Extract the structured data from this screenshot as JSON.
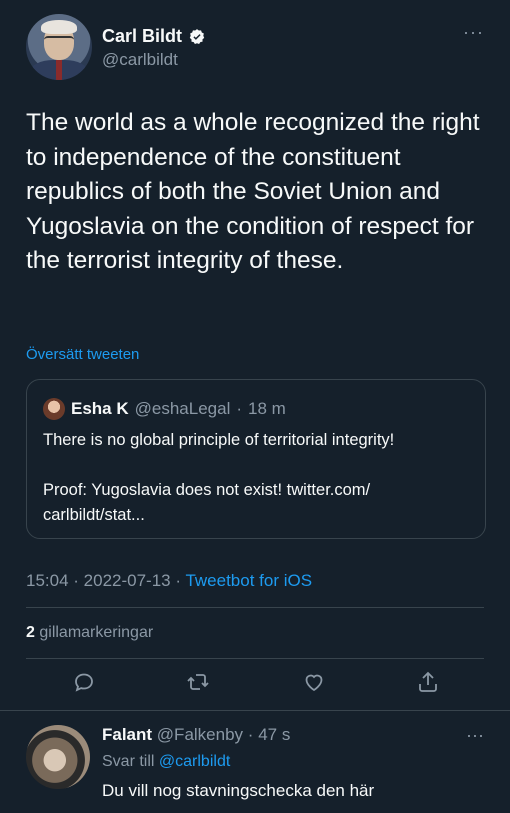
{
  "tweet": {
    "author_name": "Carl Bildt",
    "author_handle": "@carlbildt",
    "more": "···",
    "text": "The world as a whole recognized the right to independence of the constituent republics of both the Soviet Union and Yugoslavia on the condition of respect for the terrorist integrity of these.",
    "translate_label": "Översätt tweeten",
    "time": "15:04",
    "date": "2022-07-13",
    "source": "Tweetbot for iOS",
    "like_count": "2",
    "like_label": "gillamarkeringar"
  },
  "quote": {
    "name": "Esha K",
    "handle": "@eshaLegal",
    "time": "18 m",
    "line1": "There is no global principle of territorial integrity!",
    "line2": "Proof: Yugoslavia does not exist! twitter.com/",
    "line3": "carlbildt/stat..."
  },
  "reply": {
    "name": "Falant",
    "handle": "@Falkenby",
    "time": "47 s",
    "reply_to_prefix": "Svar till",
    "reply_to_handle": "@carlbildt",
    "text": "Du vill nog stavningschecka den här",
    "more": "···"
  },
  "icons": [
    "verified-badge-icon",
    "reply-icon",
    "retweet-icon",
    "like-icon",
    "share-icon",
    "more-icon"
  ],
  "colors": {
    "background": "#15202b",
    "accent": "#1d9bf0",
    "muted": "#8b98a5",
    "border": "#38444d"
  }
}
